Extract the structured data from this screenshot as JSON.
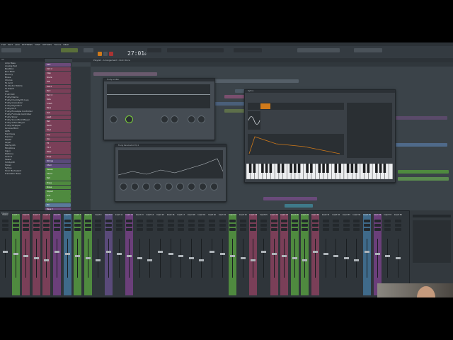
{
  "menu": [
    "FILE",
    "EDIT",
    "ADD",
    "PATTERNS",
    "VIEW",
    "OPTIONS",
    "TOOLS",
    "HELP"
  ],
  "toolbar": {
    "tempo": "27:01",
    "tempo_sub": "0"
  },
  "playlist": {
    "title": "Playlist - Arrangement › Kick Voice"
  },
  "browser": {
    "header": "All",
    "items": [
      "Amp Bass",
      "Analog Pad",
      "Beatbox",
      "Boo Bass",
      "Bouncy",
      "Brass",
      "Chorus",
      "FL Grid",
      "FL Studio Mobile",
      "FL Rapid",
      "FPC",
      "Fruit Kick",
      "Fruity Dance",
      "Fruity DrumSynth Live",
      "Fruity Granulizer",
      "Fruity Keyboard",
      "Fruity Kick",
      "Fruity Envelope Controller",
      "Fruity Formula Controller",
      "Fruity Slicer",
      "Fruity Soundfont Player",
      "Fruity Video Player",
      "Fruity Wrapper",
      "Groove Mind",
      "GMS",
      "Harmless",
      "Harmor",
      "Kepler",
      "Layer",
      "MiniSynth",
      "Morphine",
      "Ogun",
      "PoiZone",
      "Sakura",
      "Sawer",
      "SimSynth",
      "Slicex",
      "Sytrus",
      "Toxic Biohazard",
      "Transistor Bass"
    ]
  },
  "chanrack": {
    "channels": [
      {
        "label": "Kick",
        "color": "#6b4a7a"
      },
      {
        "label": "Kick 2",
        "color": "#7a3f58"
      },
      {
        "label": "Clap",
        "color": "#7a3f58"
      },
      {
        "label": "Snare",
        "color": "#7a3f58"
      },
      {
        "label": "Hat",
        "color": "#7a3f58"
      },
      {
        "label": "Hat 2",
        "color": "#7a3f58"
      },
      {
        "label": "Perc",
        "color": "#7a3f58"
      },
      {
        "label": "Perc 2",
        "color": "#7a3f58"
      },
      {
        "label": "Ride",
        "color": "#7a3f58"
      },
      {
        "label": "Crash",
        "color": "#7a3f58"
      },
      {
        "label": "Bass",
        "color": "#7a3f58"
      },
      {
        "label": "Sub",
        "color": "#7a3f58"
      },
      {
        "label": "Lead",
        "color": "#7a3f58"
      },
      {
        "label": "Pad",
        "color": "#7a3f58"
      },
      {
        "label": "Pluck",
        "color": "#7a3f58"
      },
      {
        "label": "Keys",
        "color": "#7a3f58"
      },
      {
        "label": "Arp",
        "color": "#7a3f58"
      },
      {
        "label": "Vox",
        "color": "#7a3f58"
      },
      {
        "label": "FX",
        "color": "#7a3f58"
      },
      {
        "label": "FX 2",
        "color": "#7a3f58"
      },
      {
        "label": "Riser",
        "color": "#7a3f58"
      },
      {
        "label": "Drop",
        "color": "#7a3f58"
      },
      {
        "label": "Strings",
        "color": "#5a4a7a"
      },
      {
        "label": "Choir",
        "color": "#5a4a7a"
      },
      {
        "label": "Sweep",
        "color": "#4f8a3f"
      },
      {
        "label": "Chord",
        "color": "#4f8a3f"
      },
      {
        "label": "Bell",
        "color": "#4f8a3f"
      },
      {
        "label": "Brass",
        "color": "#4f8a3f"
      },
      {
        "label": "Noise",
        "color": "#4f8a3f"
      },
      {
        "label": "Impact",
        "color": "#4f8a3f"
      },
      {
        "label": "Tom",
        "color": "#4f8a3f"
      },
      {
        "label": "Shaker",
        "color": "#4f8a3f"
      },
      {
        "label": "Fill",
        "color": "#5a7a9a"
      },
      {
        "label": "Bass 2",
        "color": "#6b4a7a"
      }
    ]
  },
  "plugins": {
    "limiter": {
      "title": "Fruity Limiter"
    },
    "eq": {
      "title": "Fruity Parametric EQ 2"
    },
    "synth": {
      "title": "Sytrus"
    }
  },
  "mixer": {
    "header": "Master",
    "strips": [
      {
        "label": "Master",
        "color": "#2f353a"
      },
      {
        "label": "Insert 1",
        "color": "#4f8a3f"
      },
      {
        "label": "Insert 2",
        "color": "#7a3f58"
      },
      {
        "label": "Insert 3",
        "color": "#7a3f58"
      },
      {
        "label": "Insert 4",
        "color": "#7a3f58"
      },
      {
        "label": "Insert 5",
        "color": "#6b3f7a"
      },
      {
        "label": "Insert 6",
        "color": "#3f6a8a"
      },
      {
        "label": "Insert 7",
        "color": "#4f8a3f"
      },
      {
        "label": "Insert 8",
        "color": "#4f8a3f"
      },
      {
        "label": "Insert 9",
        "color": "#2f353a"
      },
      {
        "label": "Insert 10",
        "color": "#5a4a7a"
      },
      {
        "label": "Insert 11",
        "color": "#2f353a"
      },
      {
        "label": "Insert 12",
        "color": "#6b3f7a"
      },
      {
        "label": "Insert 13",
        "color": "#2f353a"
      },
      {
        "label": "Insert 14",
        "color": "#2f353a"
      },
      {
        "label": "Insert 15",
        "color": "#2f353a"
      },
      {
        "label": "Insert 16",
        "color": "#2f353a"
      },
      {
        "label": "Insert 17",
        "color": "#2f353a"
      },
      {
        "label": "Insert 18",
        "color": "#2f353a"
      },
      {
        "label": "Insert 19",
        "color": "#2f353a"
      },
      {
        "label": "Insert 20",
        "color": "#2f353a"
      },
      {
        "label": "Insert 21",
        "color": "#2f353a"
      },
      {
        "label": "Insert 22",
        "color": "#4f8a3f"
      },
      {
        "label": "Insert 23",
        "color": "#2f353a"
      },
      {
        "label": "Insert 24",
        "color": "#7a3f58"
      },
      {
        "label": "Insert 25",
        "color": "#2f353a"
      },
      {
        "label": "Insert 26",
        "color": "#7a3f58"
      },
      {
        "label": "Insert 27",
        "color": "#7a3f58"
      },
      {
        "label": "Insert 28",
        "color": "#4f8a3f"
      },
      {
        "label": "Insert 29",
        "color": "#4f8a3f"
      },
      {
        "label": "Insert 30",
        "color": "#7a3f58"
      },
      {
        "label": "Insert 31",
        "color": "#2f353a"
      },
      {
        "label": "Insert 32",
        "color": "#2f353a"
      },
      {
        "label": "Insert 33",
        "color": "#2f353a"
      },
      {
        "label": "Insert 34",
        "color": "#2f353a"
      },
      {
        "label": "Insert 35",
        "color": "#3f6a8a"
      },
      {
        "label": "Insert 36",
        "color": "#6b3f7a"
      },
      {
        "label": "Insert 37",
        "color": "#2f353a"
      },
      {
        "label": "Insert 38",
        "color": "#2f353a"
      }
    ]
  }
}
